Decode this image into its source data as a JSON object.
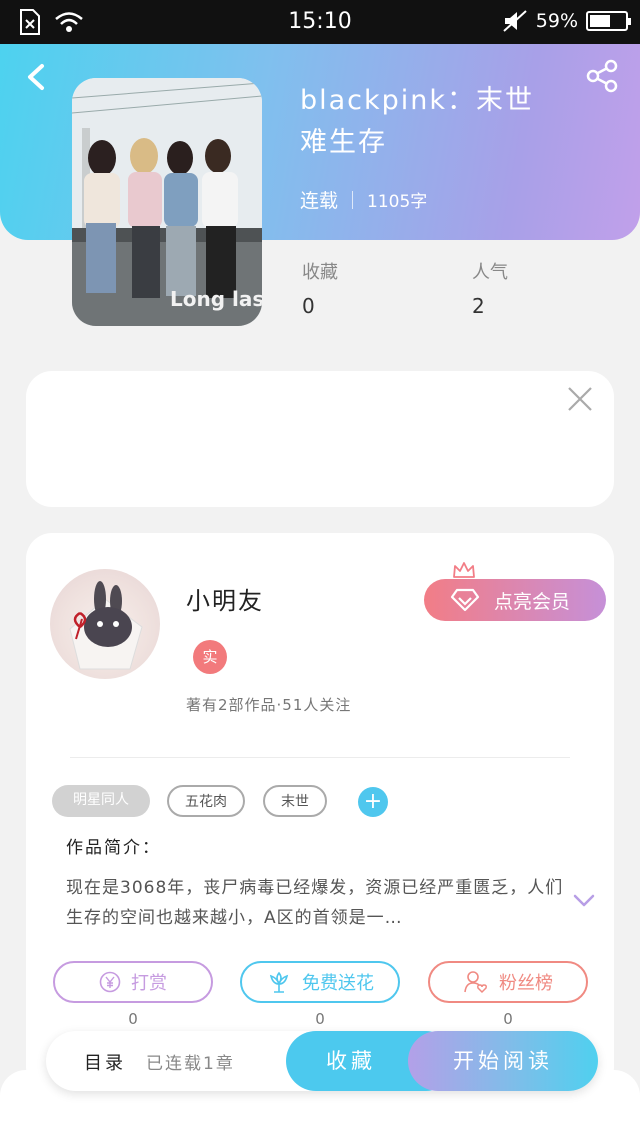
{
  "status_bar": {
    "time": "15:10",
    "battery": "59%",
    "battery_level": 0.59
  },
  "book": {
    "title": "blackpink：末世难生存",
    "status": "连载",
    "word_count": "1105字",
    "cover_text": "Long lasting"
  },
  "stats": {
    "favorites_label": "收藏",
    "favorites_value": "0",
    "popularity_label": "人气",
    "popularity_value": "2"
  },
  "author": {
    "name": "小明友",
    "badge": "实",
    "summary": "著有2部作品·51人关注",
    "vip_label": "点亮会员"
  },
  "tags": [
    "明星同人",
    "五花肉",
    "末世"
  ],
  "intro": {
    "label": "作品简介：",
    "text": "现在是3068年，丧尸病毒已经爆发，资源已经严重匮乏，人们生存的空间也越来越小，A区的首领是一…"
  },
  "actions": [
    {
      "label": "打赏",
      "count": "0",
      "color": "#c69be0"
    },
    {
      "label": "免费送花",
      "count": "0",
      "color": "#4fc7ee"
    },
    {
      "label": "粉丝榜",
      "count": "0",
      "color": "#f08a82"
    }
  ],
  "bottom_bar": {
    "toc_label": "目录",
    "chapters_label": "已连载1章",
    "collect_label": "收藏",
    "read_label": "开始阅读"
  }
}
